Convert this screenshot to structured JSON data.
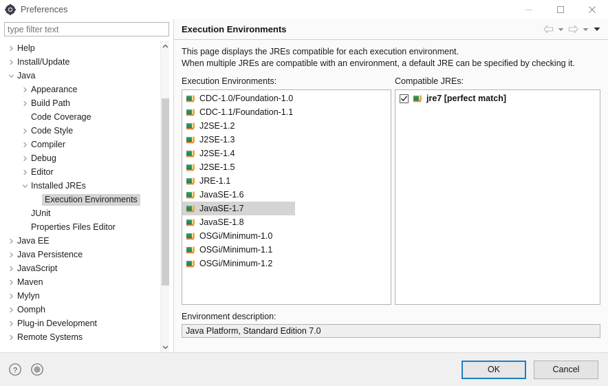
{
  "window": {
    "title": "Preferences",
    "app_icon": "gear-icon",
    "controls": {
      "minimize": "minimize-icon",
      "maximize": "maximize-icon",
      "close": "close-icon"
    }
  },
  "sidebar": {
    "filter": {
      "value": "",
      "placeholder": "type filter text"
    },
    "items": [
      {
        "label": "Help",
        "level": 0,
        "chevron": "right",
        "selected": false
      },
      {
        "label": "Install/Update",
        "level": 0,
        "chevron": "right",
        "selected": false
      },
      {
        "label": "Java",
        "level": 0,
        "chevron": "down",
        "selected": false
      },
      {
        "label": "Appearance",
        "level": 1,
        "chevron": "right",
        "selected": false
      },
      {
        "label": "Build Path",
        "level": 1,
        "chevron": "right",
        "selected": false
      },
      {
        "label": "Code Coverage",
        "level": 1,
        "chevron": "none",
        "selected": false
      },
      {
        "label": "Code Style",
        "level": 1,
        "chevron": "right",
        "selected": false
      },
      {
        "label": "Compiler",
        "level": 1,
        "chevron": "right",
        "selected": false
      },
      {
        "label": "Debug",
        "level": 1,
        "chevron": "right",
        "selected": false
      },
      {
        "label": "Editor",
        "level": 1,
        "chevron": "right",
        "selected": false
      },
      {
        "label": "Installed JREs",
        "level": 1,
        "chevron": "down",
        "selected": false
      },
      {
        "label": "Execution Environments",
        "level": 2,
        "chevron": "none",
        "selected": true
      },
      {
        "label": "JUnit",
        "level": 1,
        "chevron": "none",
        "selected": false
      },
      {
        "label": "Properties Files Editor",
        "level": 1,
        "chevron": "none",
        "selected": false
      },
      {
        "label": "Java EE",
        "level": 0,
        "chevron": "right",
        "selected": false
      },
      {
        "label": "Java Persistence",
        "level": 0,
        "chevron": "right",
        "selected": false
      },
      {
        "label": "JavaScript",
        "level": 0,
        "chevron": "right",
        "selected": false
      },
      {
        "label": "Maven",
        "level": 0,
        "chevron": "right",
        "selected": false
      },
      {
        "label": "Mylyn",
        "level": 0,
        "chevron": "right",
        "selected": false
      },
      {
        "label": "Oomph",
        "level": 0,
        "chevron": "right",
        "selected": false
      },
      {
        "label": "Plug-in Development",
        "level": 0,
        "chevron": "right",
        "selected": false
      },
      {
        "label": "Remote Systems",
        "level": 0,
        "chevron": "right",
        "selected": false
      }
    ],
    "scrollbar": {
      "up_arrow": "chevron-up-icon",
      "down_arrow": "chevron-down-icon",
      "thumb_top_pct": 15,
      "thumb_height_pct": 60
    }
  },
  "page": {
    "title": "Execution Environments",
    "nav": {
      "back": "back-arrow-icon",
      "back_menu": "chevron-down-icon",
      "forward": "forward-arrow-icon",
      "forward_menu": "chevron-down-icon",
      "more_menu": "chevron-down-filled-icon"
    },
    "description": [
      "This page displays the JREs compatible for each execution environment.",
      "When multiple JREs are compatible with an environment, a default JRE can be specified by checking it."
    ],
    "env_list": {
      "label": "Execution Environments:",
      "items": [
        {
          "label": "CDC-1.0/Foundation-1.0",
          "selected": false
        },
        {
          "label": "CDC-1.1/Foundation-1.1",
          "selected": false
        },
        {
          "label": "J2SE-1.2",
          "selected": false
        },
        {
          "label": "J2SE-1.3",
          "selected": false
        },
        {
          "label": "J2SE-1.4",
          "selected": false
        },
        {
          "label": "J2SE-1.5",
          "selected": false
        },
        {
          "label": "JRE-1.1",
          "selected": false
        },
        {
          "label": "JavaSE-1.6",
          "selected": false
        },
        {
          "label": "JavaSE-1.7",
          "selected": true
        },
        {
          "label": "JavaSE-1.8",
          "selected": false
        },
        {
          "label": "OSGi/Minimum-1.0",
          "selected": false
        },
        {
          "label": "OSGi/Minimum-1.1",
          "selected": false
        },
        {
          "label": "OSGi/Minimum-1.2",
          "selected": false
        }
      ]
    },
    "jre_list": {
      "label": "Compatible JREs:",
      "items": [
        {
          "label": "jre7 [perfect match]",
          "checked": true,
          "bold": true
        }
      ]
    },
    "env_description": {
      "label": "Environment description:",
      "value": "Java Platform, Standard Edition 7.0"
    }
  },
  "footer": {
    "help_icon": "help-icon",
    "restore_icon": "restore-defaults-icon",
    "ok_label": "OK",
    "cancel_label": "Cancel"
  },
  "colors": {
    "accent": "#1d7fc4",
    "selection": "#d4d4d4",
    "panel": "#fafafa",
    "footer": "#f0f0f0",
    "border": "#b3b3b3"
  }
}
